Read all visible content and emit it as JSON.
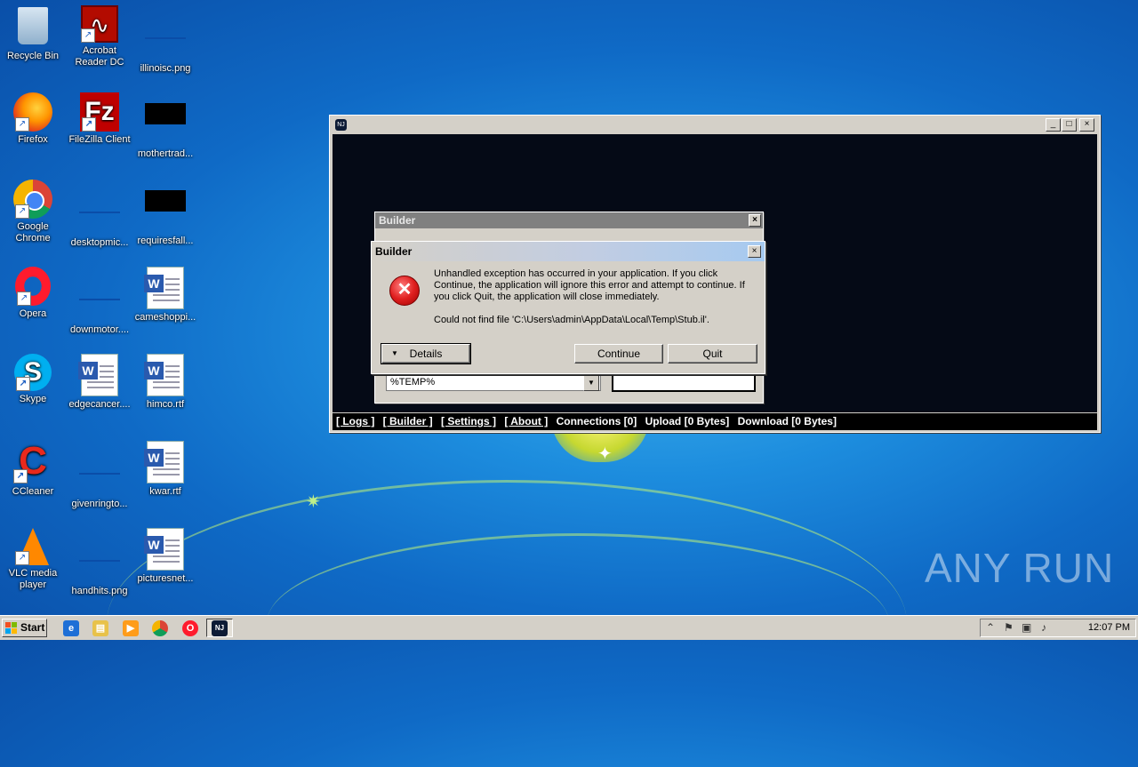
{
  "desktop": {
    "icons": [
      {
        "label": "Recycle Bin"
      },
      {
        "label": "Acrobat Reader DC"
      },
      {
        "label": "illinoisc.png"
      },
      {
        "label": "Firefox"
      },
      {
        "label": "FileZilla Client"
      },
      {
        "label": "mothertrad..."
      },
      {
        "label": "Google Chrome"
      },
      {
        "label": "desktopmic..."
      },
      {
        "label": "requiresfall..."
      },
      {
        "label": "Opera"
      },
      {
        "label": "downmotor...."
      },
      {
        "label": "cameshoppi..."
      },
      {
        "label": "Skype"
      },
      {
        "label": "edgecancer...."
      },
      {
        "label": "himco.rtf"
      },
      {
        "label": "CCleaner"
      },
      {
        "label": "givenringto..."
      },
      {
        "label": "kwar.rtf"
      },
      {
        "label": "VLC media player"
      },
      {
        "label": "handhits.png"
      },
      {
        "label": "picturesnet..."
      }
    ],
    "watermark": "ANY RUN"
  },
  "main_window": {
    "app_icon_text": "NJ",
    "controls": {
      "minimize": "_",
      "maximize": "□",
      "close": "×"
    },
    "status_bar": {
      "logs": "[ Logs ]",
      "builder": "[ Builder ]",
      "settings": "[ Settings ]",
      "about": "[ About ]",
      "connections": "Connections [0]",
      "upload": "Upload [0 Bytes]",
      "download": "Download [0 Bytes]"
    }
  },
  "builder_window": {
    "title": "Builder",
    "close": "×",
    "path_value": "%TEMP%"
  },
  "error_dialog": {
    "title": "Builder",
    "close": "×",
    "message": "Unhandled exception has occurred in your application. If you click Continue, the application will ignore this error and attempt to continue. If you click Quit, the application will close immediately.",
    "detail": "Could not find file 'C:\\Users\\admin\\AppData\\Local\\Temp\\Stub.il'.",
    "buttons": {
      "details": "Details",
      "continue": "Continue",
      "quit": "Quit"
    }
  },
  "taskbar": {
    "start_label": "Start",
    "clock": "12:07 PM"
  },
  "colors": {
    "desktop_blue": "#1d8dde",
    "main_window_bg": "#050a16",
    "error_red": "#e02020"
  }
}
